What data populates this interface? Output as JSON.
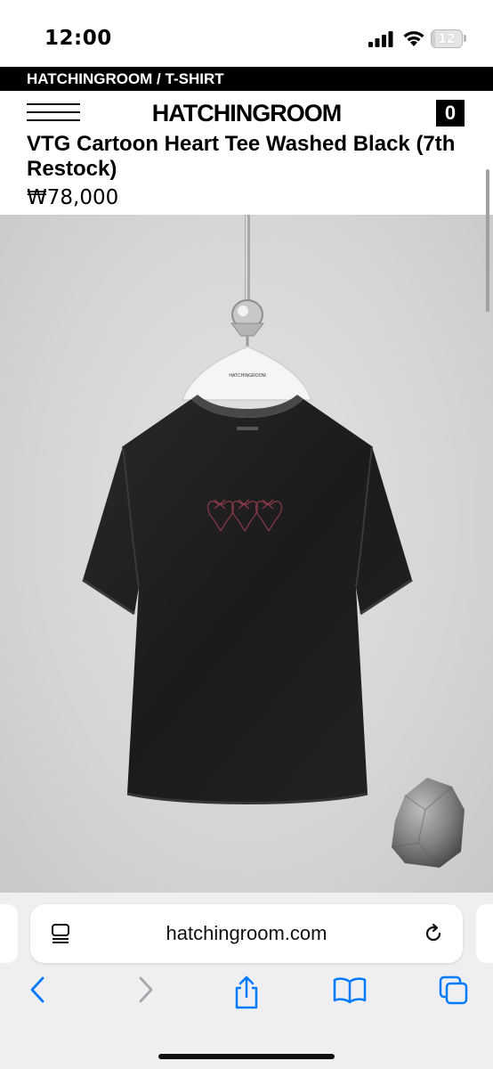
{
  "status": {
    "time": "12:00",
    "battery": "12",
    "battery_level_percent": 12
  },
  "breadcrumb": "HATCHINGROOM / T-SHIRT",
  "header": {
    "brand": "HATCHINGROOM",
    "cart_count": "0"
  },
  "product": {
    "title": "VTG Cartoon Heart Tee Washed Black (7th Restock)",
    "price": "₩78,000",
    "hanger_brand": "HATCHINGROOM"
  },
  "browser": {
    "url": "hatchingroom.com"
  },
  "icons": [
    "signal-icon",
    "wifi-icon",
    "battery-icon",
    "menu-icon",
    "tab-list-icon",
    "reload-icon",
    "back-icon",
    "forward-icon",
    "share-icon",
    "bookmarks-icon",
    "tabs-icon"
  ],
  "colors": {
    "accent": "#007aff",
    "disabled": "#a7a7ab",
    "header_bg": "#000000",
    "toolbar_bg": "#efeff1"
  }
}
